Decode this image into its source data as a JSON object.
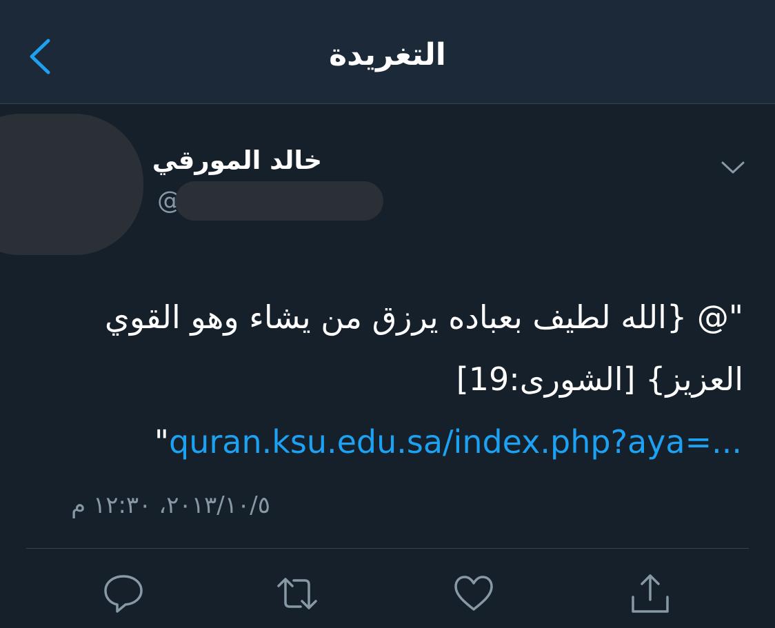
{
  "navbar": {
    "title": "التغريدة",
    "back_icon": "chevron-left-icon",
    "accent_color": "#1da1f2"
  },
  "tweet": {
    "author_name": "خالد المورقي",
    "handle_prefix": "@",
    "text_line_1": "\"@ {الله لطيف بعباده يرزق من يشاء وهو القوي",
    "text_line_2": "العزيز} [الشورى:19]",
    "link_text": "quran.ksu.edu.sa/index.php?aya=...",
    "link_close_quote": "\"",
    "timestamp": "١٠/٥/‏٢٠١٣، ١٢:٣٠ م"
  },
  "actions": [
    {
      "icon": "reply-icon"
    },
    {
      "icon": "retweet-icon"
    },
    {
      "icon": "like-icon"
    },
    {
      "icon": "share-icon"
    }
  ]
}
